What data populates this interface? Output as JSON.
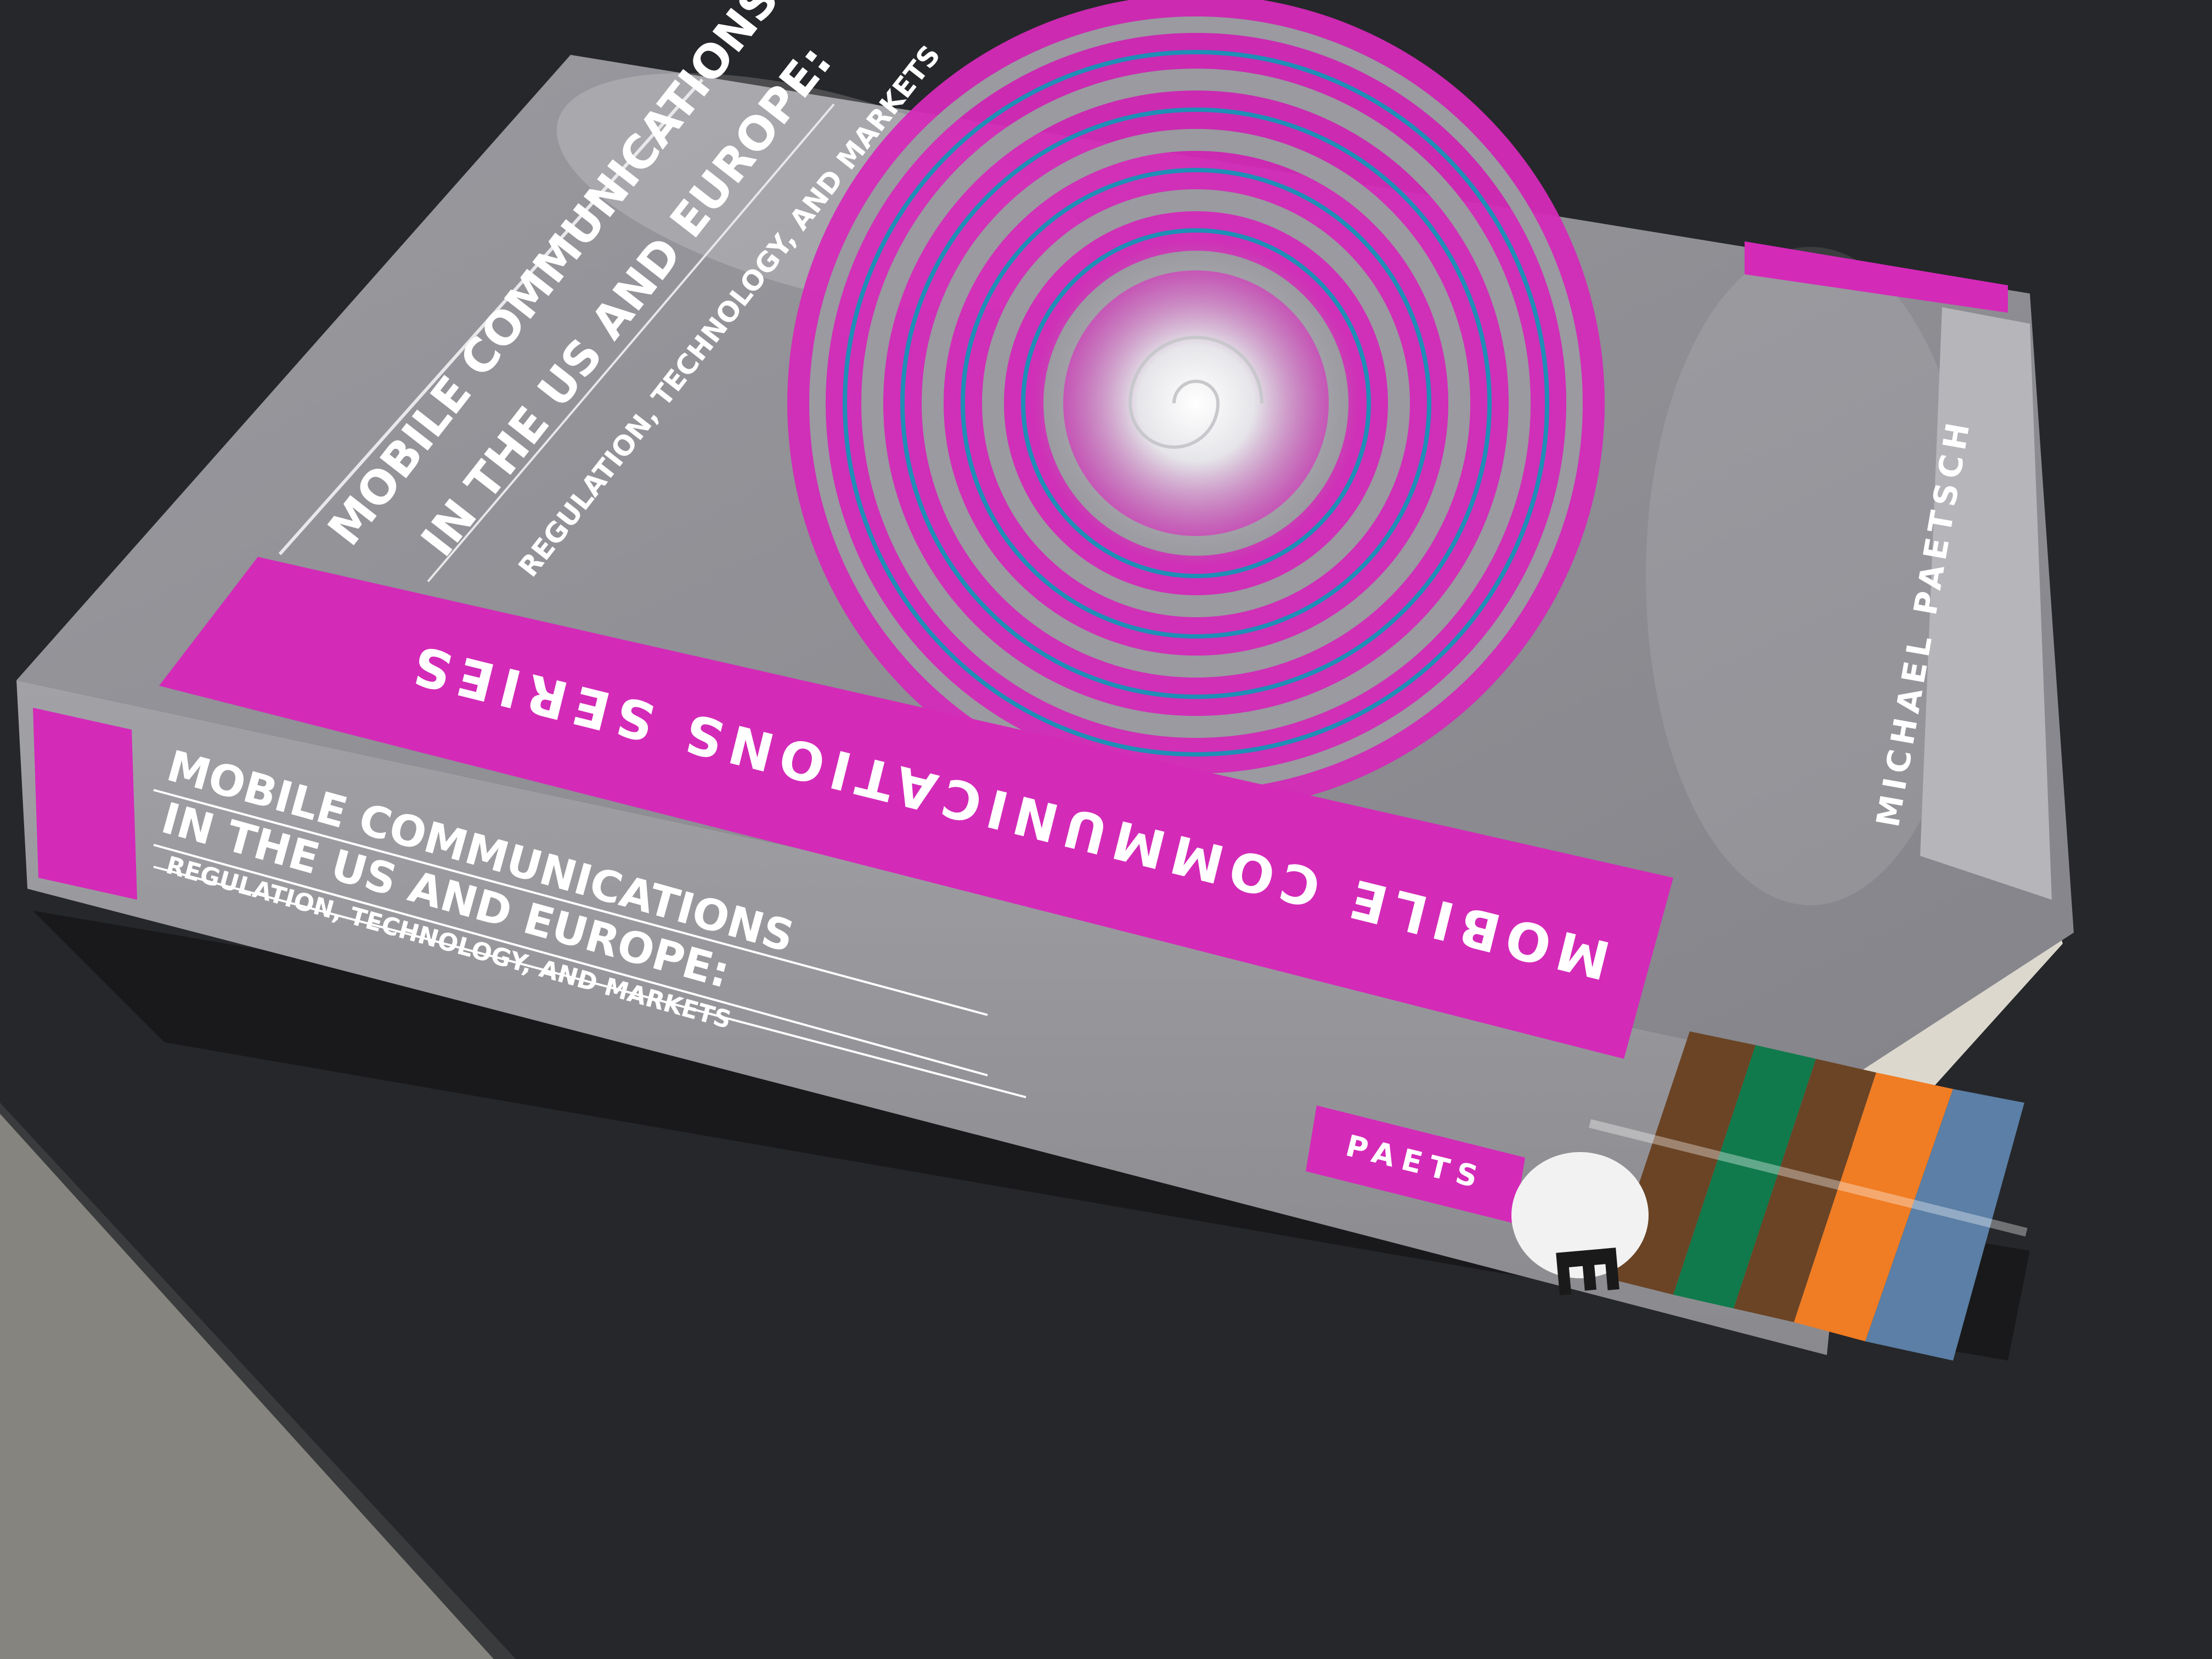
{
  "book": {
    "cover": {
      "title_line1": "MOBILE COMMUNICATIONS",
      "title_line2": "IN THE US AND EUROPE:",
      "subtitle": "REGULATION, TECHNOLOGY, AND MARKETS",
      "series": "MOBILE COMMUNICATIONS SERIES",
      "author": "MICHAEL PAETSCH"
    },
    "spine": {
      "title_line1": "MOBILE COMMUNICATIONS",
      "title_line2": "IN THE US AND EUROPE:",
      "subtitle": "REGULATION, TECHNOLOGY, AND MARKETS",
      "author_short": "PAETS",
      "library_label": "E"
    }
  },
  "colors": {
    "background": "#2a2b2e",
    "table_top": "#262729",
    "floor": "#85847e",
    "cover_gray": "#8e8e92",
    "magenta": "#d42ab8",
    "spiral_blue": "#1f8fb5",
    "pages": "#e3dfd6",
    "band_brown": "#6a4425",
    "band_green": "#107a4c",
    "band_orange": "#f07c23"
  }
}
